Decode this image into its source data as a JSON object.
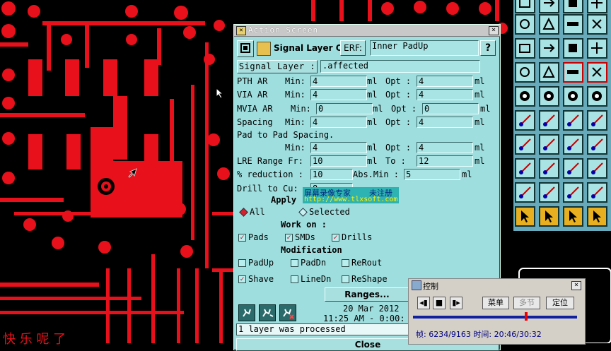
{
  "dialog": {
    "title": "Action Screen",
    "heading": "Signal Layer Opt",
    "erf_label": "ERF:",
    "erf_value": "Inner PadUp",
    "help": "?",
    "signal_layer_label": "Signal Layer :",
    "signal_layer_value": ".affected",
    "rows": {
      "pth_label": "PTH AR",
      "pth_min_label": "Min:",
      "pth_min": "4",
      "pth_unit1": "ml",
      "pth_opt_label": "Opt :",
      "pth_opt": "4",
      "pth_unit2": "ml",
      "via_label": "VIA AR",
      "via_min_label": "Min:",
      "via_min": "4",
      "via_unit1": "ml",
      "via_opt_label": "Opt :",
      "via_opt": "4",
      "via_unit2": "ml",
      "mvia_label": "MVIA AR",
      "mvia_min_label": "Min:",
      "mvia_min": "0",
      "mvia_unit1": "ml",
      "mvia_opt_label": "Opt :",
      "mvia_opt": "0",
      "mvia_unit2": "ml",
      "spacing_label": "Spacing",
      "spacing_min_label": "Min:",
      "spacing_min": "4",
      "spacing_unit1": "ml",
      "spacing_opt_label": "Opt :",
      "spacing_opt": "4",
      "spacing_unit2": "ml",
      "p2p_label": "Pad to Pad Spacing.",
      "p2p_min_label": "Min:",
      "p2p_min": "4",
      "p2p_unit1": "ml",
      "p2p_opt_label": "Opt :",
      "p2p_opt": "4",
      "p2p_unit2": "ml",
      "lre_label": "LRE Range Fr:",
      "lre_from": "10",
      "lre_unit1": "ml",
      "lre_to_label": "To :",
      "lre_to": "12",
      "lre_unit2": "ml",
      "red_label": "% reduction :",
      "red_value": "10",
      "absmin_label": "Abs.Min :",
      "absmin_value": "5",
      "absmin_unit": "ml",
      "drill_label": "Drill  to Cu:",
      "drill_value": "8"
    },
    "apply_label": "Apply",
    "all_label": "All",
    "selected_label": "Selected",
    "work_on_label": "Work on :",
    "pads_label": "Pads",
    "smds_label": "SMDs",
    "drills_label": "Drills",
    "modification_label": "Modification",
    "padup_label": "PadUp",
    "paddn_label": "PadDn",
    "rerout_label": "ReRout",
    "shave_label": "Shave",
    "linedn_label": "LineDn",
    "reshape_label": "ReShape",
    "ranges_label": "Ranges...",
    "date": "20 Mar 2012",
    "time": "11:25 AM - 0:00:",
    "status": "1 layer was processed",
    "close_label": "Close"
  },
  "watermark": {
    "line1": "屏幕录像专家",
    "line1b": "未注册",
    "line2": "http://www.tlxsoft.com"
  },
  "control": {
    "title": "控制",
    "menu_label": "菜单",
    "multi_label": "多节",
    "locate_label": "定位",
    "frame_text": "帧: 6234/9163 时间: 20:46/30:32",
    "progress": 0.68
  },
  "bottom_text": "快 乐 呢 了",
  "colors": {
    "accent_red": "#e8101a",
    "dialog_bg": "#9fdede",
    "palette_bg": "#a9e3e3"
  }
}
